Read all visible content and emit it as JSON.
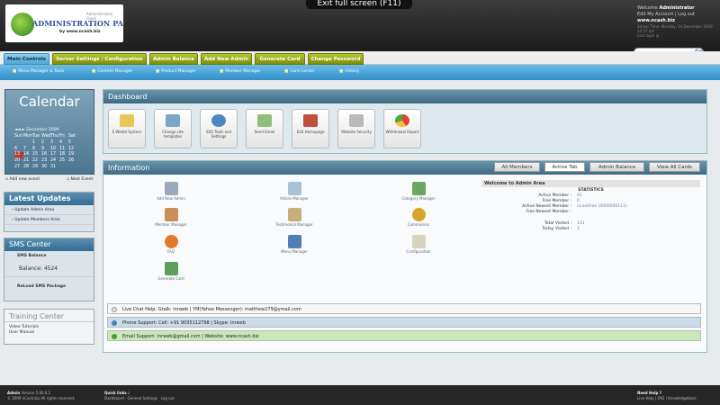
{
  "fullscreen_notice": "Exit full screen (F11)",
  "logo": {
    "top": "Administration Panel",
    "main": "ADMINISTRATION PANEL",
    "by": "by www.ncash.biz"
  },
  "top_right": {
    "welcome": "Welcome",
    "user": "Administrator",
    "links": "Edit My Account | Log out",
    "site": "www.ncash.biz",
    "server_time": "Server Time: Monday, 14 December 2009 12:57 am",
    "last_login": "Last login ip"
  },
  "search": {
    "placeholder": "",
    "go": "Go",
    "advanced": "Advanced Search"
  },
  "tabs": [
    "Main Controls",
    "Server Settings / Configuration",
    "Admin Balance",
    "Add New Admin",
    "Generate Card",
    "Change Password"
  ],
  "subnav": [
    "Menu Manager & Tools",
    "Content Manager",
    "Product Manager",
    "Member Manager",
    "Card Center",
    "History"
  ],
  "calendar": {
    "title": "Calendar",
    "month": "December 2009",
    "nav": "◄◄ ►",
    "days": [
      "Sun",
      "Mon",
      "Tue",
      "Wed",
      "Thu",
      "Fri",
      "Sat"
    ],
    "weeks": [
      [
        "",
        "",
        "1",
        "2",
        "3",
        "4",
        "5"
      ],
      [
        "6",
        "7",
        "8",
        "9",
        "10",
        "11",
        "12"
      ],
      [
        "13",
        "14",
        "15",
        "16",
        "17",
        "18",
        "19"
      ],
      [
        "20",
        "21",
        "22",
        "23",
        "24",
        "25",
        "26"
      ],
      [
        "27",
        "28",
        "29",
        "30",
        "31",
        "",
        ""
      ]
    ],
    "add_event": "Add new event",
    "next_event": "Next Event"
  },
  "latest_updates": {
    "title": "Latest Updates",
    "items": [
      "Update Admin Area",
      "Update Members Area"
    ]
  },
  "sms": {
    "title": "SMS Center",
    "balance_label": "SMS Balance",
    "balance": "Balance: 4524",
    "reload": "ReLoad SMS Package"
  },
  "training": {
    "title": "Training Center",
    "items": [
      "Video Tutorials",
      "User Manual"
    ]
  },
  "dashboard": {
    "title": "Dashboard",
    "icons": [
      "E-Wallet System",
      "Change site templates",
      "SEO Tools and Settings",
      "Send Email",
      "Edit Homepage",
      "Website Security",
      "Withdrawal Report"
    ]
  },
  "information": {
    "title": "Information",
    "tabs": [
      "All Members",
      "Active Tab",
      "Admin Balance",
      "View All Cards"
    ],
    "items": [
      "Add New Admin",
      "Article Manager",
      "Category Manager",
      "Member Manager",
      "Testimonial Manager",
      "Commission",
      "FAQ",
      "Menu Manager",
      "Configuration",
      "Generate Card"
    ]
  },
  "welcome": {
    "title": "Welcome to Admin Area",
    "statistics": "STATISTICS",
    "lines": [
      [
        "Active Member :",
        "41"
      ],
      [
        "Free Member :",
        "0"
      ],
      [
        "Active Newest Member :",
        "ncashfree (0000000111)"
      ],
      [
        "Free Newest Member :",
        ""
      ],
      [
        "Total Visited :",
        "131"
      ],
      [
        "Today Visited :",
        "1"
      ]
    ]
  },
  "support": [
    "Live Chat Help: Gtalk: inrweb | YM(Yahoo Messenger): matthew279@ymail.com",
    "Phone Support: Cell: +91 9035112798 | Skype: inrweb",
    "Email Support: inrweb@gmail.com | Website: www.ncash.biz"
  ],
  "footer": {
    "col1_title": "Admin",
    "col1_ver": "Version 5.00.0.1",
    "col1_copy": "© 2009 nCash.biz All rights reserved.",
    "col2_title": "Quick links :",
    "col2_links": "Dashboard · General Settings · Log out",
    "col3_title": "Need Help ?",
    "col3_links": "Live Help | FAQ | Knowledgebase"
  }
}
